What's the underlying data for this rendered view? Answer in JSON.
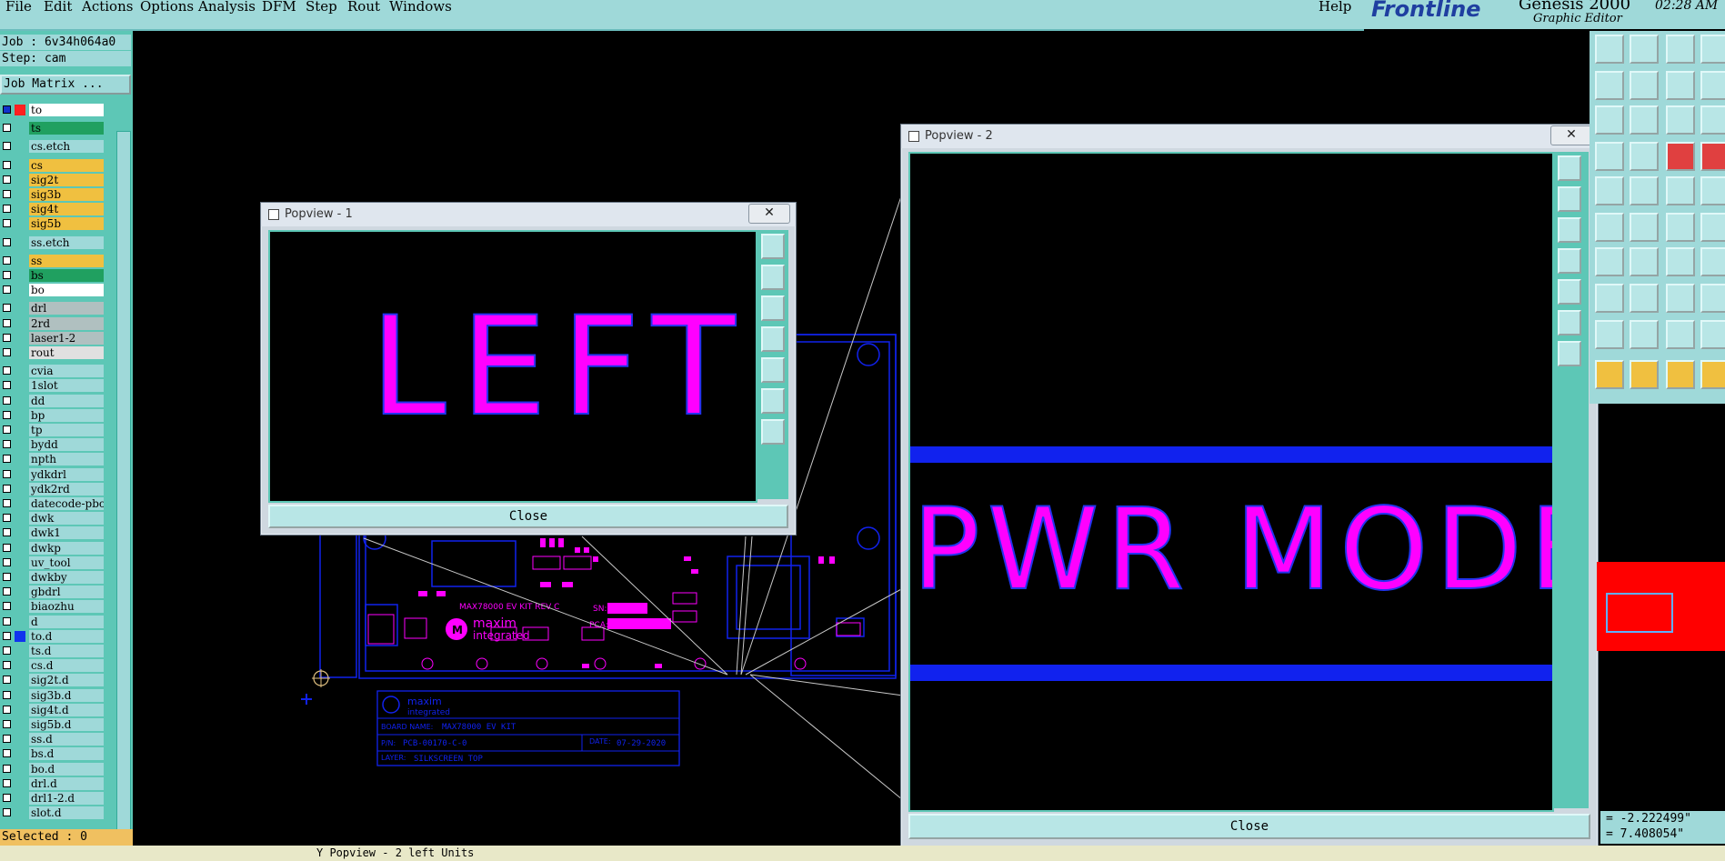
{
  "menubar": {
    "items": [
      "File",
      "Edit",
      "Actions",
      "Options",
      "Analysis",
      "DFM",
      "Step",
      "Rout",
      "Windows"
    ],
    "help": "Help"
  },
  "brand": {
    "logo": "Frontline",
    "product": "Genesis 2000",
    "subtitle": "Graphic Editor",
    "clock": "02:28 AM"
  },
  "job": {
    "job_label": "Job : 6v34h064a0",
    "step_label": "Step: cam",
    "matrix_button": "Job Matrix ..."
  },
  "layers": [
    {
      "name": "to",
      "color": "#ffffff",
      "swatch": "#ff2020",
      "sel": true
    },
    {
      "name": "ts",
      "color": "#20a060",
      "swatch": "",
      "sel": false
    },
    {
      "name": "cs.etch",
      "color": "#9fd9d9",
      "swatch": "",
      "sel": false
    },
    {
      "name": "cs",
      "color": "#f0c040",
      "swatch": "",
      "sel": false
    },
    {
      "name": "sig2t",
      "color": "#f0c040",
      "swatch": "",
      "sel": false
    },
    {
      "name": "sig3b",
      "color": "#f0c040",
      "swatch": "",
      "sel": false
    },
    {
      "name": "sig4t",
      "color": "#f0c040",
      "swatch": "",
      "sel": false
    },
    {
      "name": "sig5b",
      "color": "#f0c040",
      "swatch": "",
      "sel": false
    },
    {
      "name": "ss.etch",
      "color": "#9fd9d9",
      "swatch": "",
      "sel": false
    },
    {
      "name": "ss",
      "color": "#f0c040",
      "swatch": "",
      "sel": false
    },
    {
      "name": "bs",
      "color": "#20a060",
      "swatch": "",
      "sel": false
    },
    {
      "name": "bo",
      "color": "#ffffff",
      "swatch": "",
      "sel": false
    },
    {
      "name": "drl",
      "color": "#b0c0c0",
      "swatch": "",
      "sel": false
    },
    {
      "name": "2rd",
      "color": "#b0c0c0",
      "swatch": "",
      "sel": false
    },
    {
      "name": "laser1-2",
      "color": "#b0c0c0",
      "swatch": "",
      "sel": false
    },
    {
      "name": "rout",
      "color": "#e0e0e0",
      "swatch": "",
      "sel": false
    },
    {
      "name": "cvia",
      "color": "#9fd9d9",
      "swatch": "",
      "sel": false
    },
    {
      "name": "1slot",
      "color": "#9fd9d9",
      "swatch": "",
      "sel": false
    },
    {
      "name": "dd",
      "color": "#9fd9d9",
      "swatch": "",
      "sel": false
    },
    {
      "name": "bp",
      "color": "#9fd9d9",
      "swatch": "",
      "sel": false
    },
    {
      "name": "tp",
      "color": "#9fd9d9",
      "swatch": "",
      "sel": false
    },
    {
      "name": "bydd",
      "color": "#9fd9d9",
      "swatch": "",
      "sel": false
    },
    {
      "name": "npth",
      "color": "#9fd9d9",
      "swatch": "",
      "sel": false
    },
    {
      "name": "ydkdrl",
      "color": "#9fd9d9",
      "swatch": "",
      "sel": false
    },
    {
      "name": "ydk2rd",
      "color": "#9fd9d9",
      "swatch": "",
      "sel": false
    },
    {
      "name": "datecode-pbo",
      "color": "#9fd9d9",
      "swatch": "",
      "sel": false
    },
    {
      "name": "dwk",
      "color": "#9fd9d9",
      "swatch": "",
      "sel": false
    },
    {
      "name": "dwk1",
      "color": "#9fd9d9",
      "swatch": "",
      "sel": false
    },
    {
      "name": "dwkp",
      "color": "#9fd9d9",
      "swatch": "",
      "sel": false
    },
    {
      "name": "uv_tool",
      "color": "#9fd9d9",
      "swatch": "",
      "sel": false
    },
    {
      "name": "dwkby",
      "color": "#9fd9d9",
      "swatch": "",
      "sel": false
    },
    {
      "name": "gbdrl",
      "color": "#9fd9d9",
      "swatch": "",
      "sel": false
    },
    {
      "name": "biaozhu",
      "color": "#9fd9d9",
      "swatch": "",
      "sel": false
    },
    {
      "name": "d",
      "color": "#9fd9d9",
      "swatch": "",
      "sel": false
    },
    {
      "name": "to.d",
      "color": "#9fd9d9",
      "swatch": "#1133ee",
      "sel": false
    },
    {
      "name": "ts.d",
      "color": "#9fd9d9",
      "swatch": "",
      "sel": false
    },
    {
      "name": "cs.d",
      "color": "#9fd9d9",
      "swatch": "",
      "sel": false
    },
    {
      "name": "sig2t.d",
      "color": "#9fd9d9",
      "swatch": "",
      "sel": false
    },
    {
      "name": "sig3b.d",
      "color": "#9fd9d9",
      "swatch": "",
      "sel": false
    },
    {
      "name": "sig4t.d",
      "color": "#9fd9d9",
      "swatch": "",
      "sel": false
    },
    {
      "name": "sig5b.d",
      "color": "#9fd9d9",
      "swatch": "",
      "sel": false
    },
    {
      "name": "ss.d",
      "color": "#9fd9d9",
      "swatch": "",
      "sel": false
    },
    {
      "name": "bs.d",
      "color": "#9fd9d9",
      "swatch": "",
      "sel": false
    },
    {
      "name": "bo.d",
      "color": "#9fd9d9",
      "swatch": "",
      "sel": false
    },
    {
      "name": "drl.d",
      "color": "#9fd9d9",
      "swatch": "",
      "sel": false
    },
    {
      "name": "drl1-2.d",
      "color": "#9fd9d9",
      "swatch": "",
      "sel": false
    },
    {
      "name": "slot.d",
      "color": "#9fd9d9",
      "swatch": "",
      "sel": false
    }
  ],
  "selected": "Selected : 0",
  "board": {
    "silk_model": "MAX78000 EV KIT REV C",
    "brand1": "maxim",
    "brand2": "integrated",
    "sn_label": "SN:",
    "pca_label": "PCA:",
    "tb_board_name_label": "BOARD NAME:",
    "tb_board_name": "MAX78000 EV KIT",
    "tb_pn_label": "P/N:",
    "tb_pn": "PCB-00170-C-0",
    "tb_date_label": "DATE:",
    "tb_date": "07-29-2020",
    "tb_layer_label": "LAYER:",
    "tb_layer": "SILKSCREEN TOP"
  },
  "popview1": {
    "title": "Popview - 1",
    "content": "LEFT",
    "close": "Close",
    "x": "✕"
  },
  "popview2": {
    "title": "Popview - 2",
    "content": "PWR MODE SE",
    "close": "Close",
    "x": "✕"
  },
  "coords": {
    "x": "= -2.222499\"",
    "y": "= 7.408054\""
  },
  "statusbar": {
    "cmd": "Y Popview - 2 left Units"
  },
  "colors": {
    "silk": "#ff00ff",
    "outline": "#1122ee",
    "panel": "#9fd9d9",
    "accent": "#5dc7b6"
  }
}
